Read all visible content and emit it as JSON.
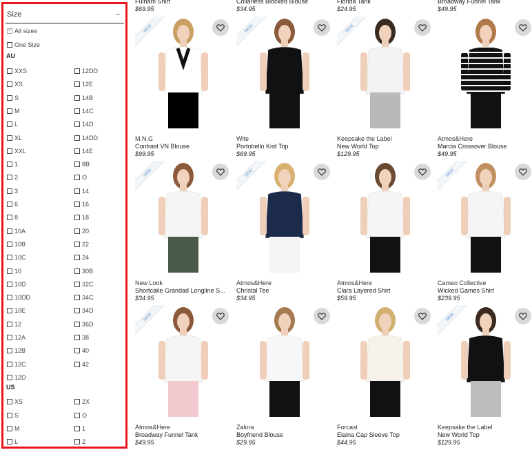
{
  "filter": {
    "title": "Size",
    "collapse_symbol": "–",
    "all_sizes": "All sizes",
    "one_size": "One Size",
    "au_heading": "AU",
    "au_col1": [
      "XXS",
      "XS",
      "S",
      "M",
      "L",
      "XL",
      "XXL",
      "1",
      "2",
      "3",
      "6",
      "8",
      "10A",
      "10B",
      "10C",
      "10",
      "10D",
      "10DD",
      "10E",
      "12",
      "12A",
      "12B",
      "12C",
      "12D"
    ],
    "au_col2": [
      "12DD",
      "12E",
      "14B",
      "14C",
      "14D",
      "14DD",
      "14E",
      "8B",
      "O",
      "14",
      "16",
      "18",
      "20",
      "22",
      "24",
      "30B",
      "32C",
      "34C",
      "34D",
      "36D",
      "38",
      "40",
      "42"
    ],
    "us_heading": "US",
    "us_col1": [
      "XS",
      "S",
      "M",
      "L"
    ],
    "us_col2": [
      "2X",
      "O",
      "1",
      "2"
    ]
  },
  "new_badge": "NEW",
  "products": [
    {
      "brand": "",
      "name": "Fulham Shirt",
      "price": "$69.95",
      "is_new": true,
      "top": "white",
      "bottom": "black",
      "hair": "#c9a062",
      "collar": "#111"
    },
    {
      "brand": "",
      "name": "Collarless Blocked Blouse",
      "price": "$34.95",
      "is_new": true,
      "top": "#111",
      "bottom": "#111",
      "hair": "#8a5a3a",
      "collar": ""
    },
    {
      "brand": "",
      "name": "Florida Tank",
      "price": "$24.95",
      "is_new": true,
      "top": "#f2f2f2",
      "bottom": "#b9b9b9",
      "hair": "#3a2a20",
      "collar": ""
    },
    {
      "brand": "",
      "name": "Broadway Funnel Tank",
      "price": "$49.95",
      "is_new": false,
      "top": "stripe",
      "bottom": "#111",
      "hair": "#b07a4a",
      "collar": ""
    },
    {
      "brand": "M.N.G",
      "name": "Contrast VN Blouse",
      "price": "$99.95",
      "is_new": true,
      "top": "#f5f5f5",
      "bottom": "#4b5a4a",
      "hair": "#8a5a3a",
      "collar": ""
    },
    {
      "brand": "Wite",
      "name": "Portobello Knit Top",
      "price": "$69.95",
      "is_new": true,
      "top": "#1d2b4a",
      "bottom": "#f5f5f5",
      "hair": "#d9b070",
      "collar": ""
    },
    {
      "brand": "Keepsake the Label",
      "name": "New World Top",
      "price": "$129.95",
      "is_new": true,
      "top": "#f5f5f5",
      "bottom": "#111",
      "hair": "#6a4a34",
      "collar": ""
    },
    {
      "brand": "Atmos&Here",
      "name": "Marcia Crossover Blouse",
      "price": "$49.95",
      "is_new": true,
      "top": "#f5f5f5",
      "bottom": "#111",
      "hair": "#c09060",
      "collar": ""
    },
    {
      "brand": "New Look",
      "name": "Shortcake Grandad Longline S...",
      "price": "$34.95",
      "is_new": true,
      "top": "#f5f5f5",
      "bottom": "#f2c9cf",
      "hair": "#8a5a3a",
      "collar": ""
    },
    {
      "brand": "Atmos&Here",
      "name": "Christal Tee",
      "price": "$34.95",
      "is_new": true,
      "top": "#f7f7f7",
      "bottom": "#111",
      "hair": "#a57a50",
      "collar": ""
    },
    {
      "brand": "Atmos&Here",
      "name": "Clara Layered Shirt",
      "price": "$59.95",
      "is_new": false,
      "top": "#f7f3ea",
      "bottom": "#111",
      "hair": "#d2b070",
      "collar": ""
    },
    {
      "brand": "Cameo Collective",
      "name": "Wicked Games Shirt",
      "price": "$239.95",
      "is_new": true,
      "top": "#111",
      "bottom": "#bdbdbd",
      "hair": "#3a2a20",
      "collar": ""
    },
    {
      "brand": "Atmos&Here",
      "name": "Broadway Funnel Tank",
      "price": "$49.95",
      "is_new": false,
      "top": "",
      "bottom": "",
      "hair": "",
      "collar": ""
    },
    {
      "brand": "Zalora",
      "name": "Boyfriend Blouse",
      "price": "$29.95",
      "is_new": false,
      "top": "",
      "bottom": "",
      "hair": "",
      "collar": ""
    },
    {
      "brand": "Forcast",
      "name": "Elaina Cap Sleeve Top",
      "price": "$44.95",
      "is_new": false,
      "top": "",
      "bottom": "",
      "hair": "",
      "collar": ""
    },
    {
      "brand": "Keepsake the Label",
      "name": "New World Top",
      "price": "$129.95",
      "is_new": false,
      "top": "",
      "bottom": "",
      "hair": "",
      "collar": ""
    }
  ]
}
